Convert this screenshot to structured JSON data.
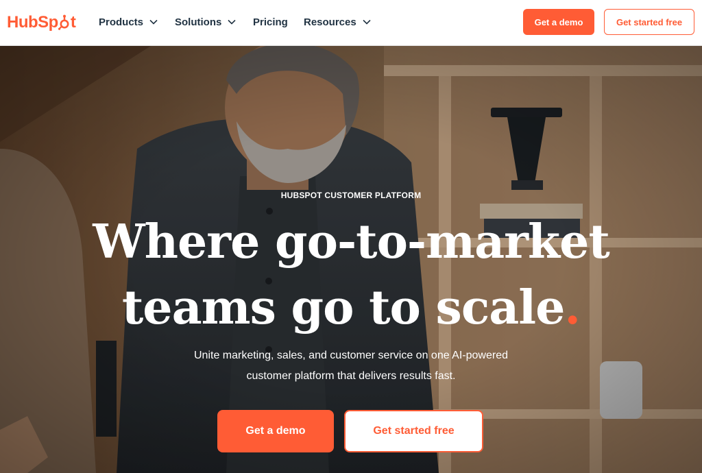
{
  "nav": {
    "logo_text": "HubSpot",
    "items": [
      {
        "label": "Products",
        "has_dropdown": true
      },
      {
        "label": "Solutions",
        "has_dropdown": true
      },
      {
        "label": "Pricing",
        "has_dropdown": false
      },
      {
        "label": "Resources",
        "has_dropdown": true
      }
    ],
    "cta_demo": "Get a demo",
    "cta_free": "Get started free"
  },
  "hero": {
    "eyebrow": "HUBSPOT CUSTOMER PLATFORM",
    "headline_line1": "Where go-to-market",
    "headline_line2": "teams go to scale",
    "headline_punct": ".",
    "subtitle_line1": "Unite marketing, sales, and customer service on one AI-powered",
    "subtitle_line2": "customer platform that delivers results fast.",
    "cta_demo": "Get a demo",
    "cta_free": "Get started free"
  },
  "colors": {
    "brand_orange": "#ff5c35",
    "nav_text": "#213343"
  },
  "icons": [
    "hubspot-sprocket-icon",
    "chevron-down-icon"
  ]
}
